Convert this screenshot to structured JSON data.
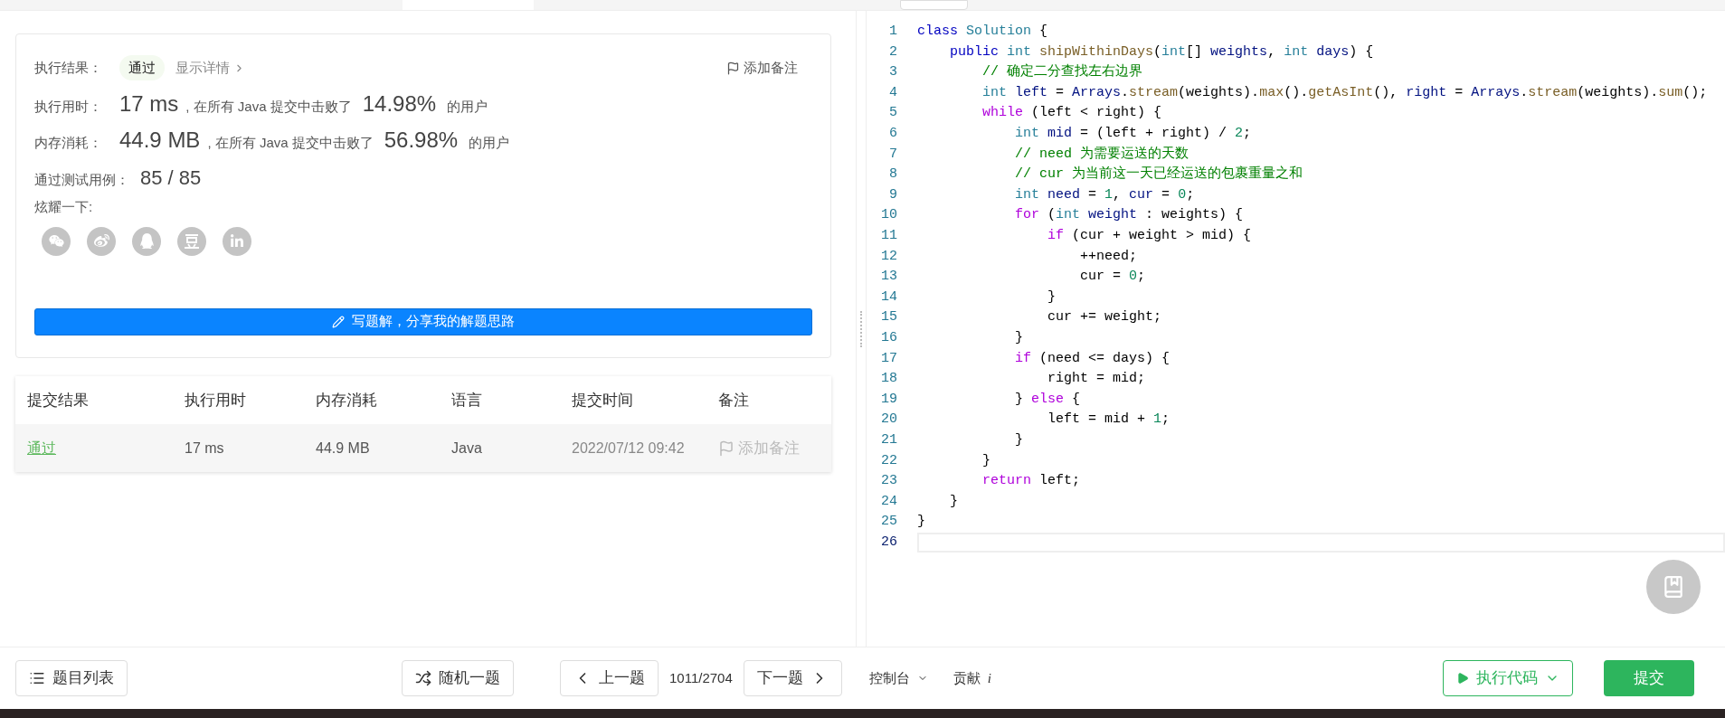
{
  "result_card": {
    "status_label": "执行结果：",
    "status": "通过",
    "details_link": "显示详情",
    "add_note": "添加备注",
    "runtime": {
      "label": "执行用时：",
      "value": "17 ms",
      "text": ", 在所有 Java 提交中击败了",
      "percent": "14.98%",
      "suffix": "的用户"
    },
    "memory": {
      "label": "内存消耗：",
      "value": "44.9 MB",
      "text": ", 在所有 Java 提交中击败了",
      "percent": "56.98%",
      "suffix": "的用户"
    },
    "tests": {
      "label": "通过测试用例：",
      "value": "85 / 85"
    },
    "share_label": "炫耀一下:",
    "write_button": "写题解，分享我的解题思路"
  },
  "submissions": {
    "columns": [
      "提交结果",
      "执行用时",
      "内存消耗",
      "语言",
      "提交时间",
      "备注"
    ],
    "rows": [
      {
        "status": "通过",
        "runtime": "17 ms",
        "memory": "44.9 MB",
        "language": "Java",
        "time": "2022/07/12 09:42",
        "note": "添加备注"
      }
    ]
  },
  "editor": {
    "lines": [
      {
        "number": "1",
        "current": false,
        "tokens": [
          {
            "text": "class",
            "kind": "decl"
          },
          {
            "text": " Solution",
            "kind": "type"
          },
          {
            "text": " {",
            "kind": "p"
          }
        ]
      },
      {
        "number": "2",
        "current": false,
        "tokens": [
          {
            "text": "    public",
            "kind": "decl"
          },
          {
            "text": " int",
            "kind": "type"
          },
          {
            "text": " shipWithinDays",
            "kind": "fn"
          },
          {
            "text": "(",
            "kind": "p"
          },
          {
            "text": "int",
            "kind": "type"
          },
          {
            "text": "[] ",
            "kind": "p"
          },
          {
            "text": "weights",
            "kind": "var"
          },
          {
            "text": ", ",
            "kind": "p"
          },
          {
            "text": "int",
            "kind": "type"
          },
          {
            "text": " days",
            "kind": "var"
          },
          {
            "text": ") {",
            "kind": "p"
          }
        ]
      },
      {
        "number": "3",
        "current": false,
        "tokens": [
          {
            "text": "        // 确定二分查找左右边界",
            "kind": "cmt"
          }
        ]
      },
      {
        "number": "4",
        "current": false,
        "tokens": [
          {
            "text": "        int",
            "kind": "type"
          },
          {
            "text": " left",
            "kind": "var"
          },
          {
            "text": " = ",
            "kind": "p"
          },
          {
            "text": "Arrays",
            "kind": "var"
          },
          {
            "text": ".",
            "kind": "p"
          },
          {
            "text": "stream",
            "kind": "fn"
          },
          {
            "text": "(weights).",
            "kind": "p"
          },
          {
            "text": "max",
            "kind": "fn"
          },
          {
            "text": "().",
            "kind": "p"
          },
          {
            "text": "getAsInt",
            "kind": "fn"
          },
          {
            "text": "(), ",
            "kind": "p"
          },
          {
            "text": "right",
            "kind": "var"
          },
          {
            "text": " = ",
            "kind": "p"
          },
          {
            "text": "Arrays",
            "kind": "var"
          },
          {
            "text": ".",
            "kind": "p"
          },
          {
            "text": "stream",
            "kind": "fn"
          },
          {
            "text": "(weights).",
            "kind": "p"
          },
          {
            "text": "sum",
            "kind": "fn"
          },
          {
            "text": "();",
            "kind": "p"
          }
        ]
      },
      {
        "number": "5",
        "current": false,
        "tokens": [
          {
            "text": "        while",
            "kind": "ctrl"
          },
          {
            "text": " (left < right) {",
            "kind": "p"
          }
        ]
      },
      {
        "number": "6",
        "current": false,
        "tokens": [
          {
            "text": "            int",
            "kind": "type"
          },
          {
            "text": " mid",
            "kind": "var"
          },
          {
            "text": " = (left + right) / ",
            "kind": "p"
          },
          {
            "text": "2",
            "kind": "num"
          },
          {
            "text": ";",
            "kind": "p"
          }
        ]
      },
      {
        "number": "7",
        "current": false,
        "tokens": [
          {
            "text": "            // need 为需要运送的天数",
            "kind": "cmt"
          }
        ]
      },
      {
        "number": "8",
        "current": false,
        "tokens": [
          {
            "text": "            // cur 为当前这一天已经运送的包裹重量之和",
            "kind": "cmt"
          }
        ]
      },
      {
        "number": "9",
        "current": false,
        "tokens": [
          {
            "text": "            int",
            "kind": "type"
          },
          {
            "text": " need",
            "kind": "var"
          },
          {
            "text": " = ",
            "kind": "p"
          },
          {
            "text": "1",
            "kind": "num"
          },
          {
            "text": ", ",
            "kind": "p"
          },
          {
            "text": "cur",
            "kind": "var"
          },
          {
            "text": " = ",
            "kind": "p"
          },
          {
            "text": "0",
            "kind": "num"
          },
          {
            "text": ";",
            "kind": "p"
          }
        ]
      },
      {
        "number": "10",
        "current": false,
        "tokens": [
          {
            "text": "            for",
            "kind": "ctrl"
          },
          {
            "text": " (",
            "kind": "p"
          },
          {
            "text": "int",
            "kind": "type"
          },
          {
            "text": " weight",
            "kind": "var"
          },
          {
            "text": " : weights) {",
            "kind": "p"
          }
        ]
      },
      {
        "number": "11",
        "current": false,
        "tokens": [
          {
            "text": "                if",
            "kind": "ctrl"
          },
          {
            "text": " (cur + weight > mid) {",
            "kind": "p"
          }
        ]
      },
      {
        "number": "12",
        "current": false,
        "tokens": [
          {
            "text": "                    ++need;",
            "kind": "p"
          }
        ]
      },
      {
        "number": "13",
        "current": false,
        "tokens": [
          {
            "text": "                    cur = ",
            "kind": "p"
          },
          {
            "text": "0",
            "kind": "num"
          },
          {
            "text": ";",
            "kind": "p"
          }
        ]
      },
      {
        "number": "14",
        "current": false,
        "tokens": [
          {
            "text": "                }",
            "kind": "p"
          }
        ]
      },
      {
        "number": "15",
        "current": false,
        "tokens": [
          {
            "text": "                cur += weight;",
            "kind": "p"
          }
        ]
      },
      {
        "number": "16",
        "current": false,
        "tokens": [
          {
            "text": "            }",
            "kind": "p"
          }
        ]
      },
      {
        "number": "17",
        "current": false,
        "tokens": [
          {
            "text": "            if",
            "kind": "ctrl"
          },
          {
            "text": " (need <= days) {",
            "kind": "p"
          }
        ]
      },
      {
        "number": "18",
        "current": false,
        "tokens": [
          {
            "text": "                right = mid;",
            "kind": "p"
          }
        ]
      },
      {
        "number": "19",
        "current": false,
        "tokens": [
          {
            "text": "            } ",
            "kind": "p"
          },
          {
            "text": "else",
            "kind": "ctrl"
          },
          {
            "text": " {",
            "kind": "p"
          }
        ]
      },
      {
        "number": "20",
        "current": false,
        "tokens": [
          {
            "text": "                left = mid + ",
            "kind": "p"
          },
          {
            "text": "1",
            "kind": "num"
          },
          {
            "text": ";",
            "kind": "p"
          }
        ]
      },
      {
        "number": "21",
        "current": false,
        "tokens": [
          {
            "text": "            }",
            "kind": "p"
          }
        ]
      },
      {
        "number": "22",
        "current": false,
        "tokens": [
          {
            "text": "        }",
            "kind": "p"
          }
        ]
      },
      {
        "number": "23",
        "current": false,
        "tokens": [
          {
            "text": "        return",
            "kind": "ctrl"
          },
          {
            "text": " left;",
            "kind": "p"
          }
        ]
      },
      {
        "number": "24",
        "current": false,
        "tokens": [
          {
            "text": "    }",
            "kind": "p"
          }
        ]
      },
      {
        "number": "25",
        "current": false,
        "tokens": [
          {
            "text": "}",
            "kind": "p"
          }
        ]
      },
      {
        "number": "26",
        "current": true
      }
    ]
  },
  "bottom_bar": {
    "problem_list": "题目列表",
    "random": "随机一题",
    "prev": "上一题",
    "counter": "1011/2704",
    "next": "下一题",
    "console": "控制台",
    "contribute": "贡献",
    "contribute_info": "i",
    "run": "执行代码",
    "submit": "提交"
  }
}
